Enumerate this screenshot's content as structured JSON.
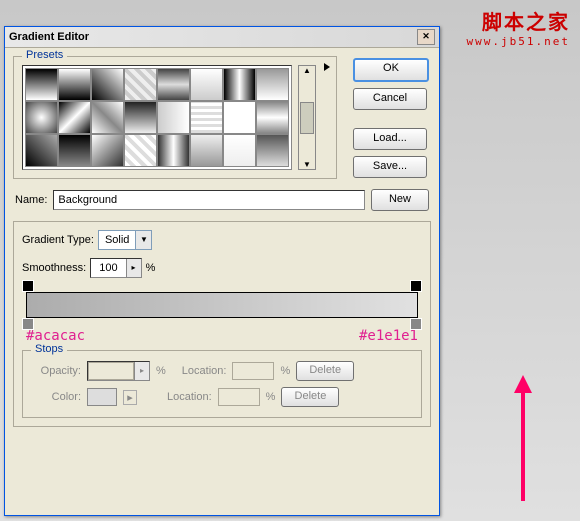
{
  "watermark": {
    "cn": "脚本之家",
    "en": "www.jb51.net"
  },
  "dialog": {
    "title": "Gradient Editor",
    "buttons": {
      "ok": "OK",
      "cancel": "Cancel",
      "load": "Load...",
      "save": "Save...",
      "new": "New"
    },
    "presets_label": "Presets",
    "name_label": "Name:",
    "name_value": "Background",
    "gradient_type_label": "Gradient Type:",
    "gradient_type_value": "Solid",
    "smoothness_label": "Smoothness:",
    "smoothness_value": "100",
    "percent": "%",
    "hex_left": "#acacac",
    "hex_right": "#e1e1e1",
    "stops": {
      "legend": "Stops",
      "opacity": "Opacity:",
      "color": "Color:",
      "location": "Location:",
      "delete": "Delete"
    },
    "presets": [
      "linear-gradient(#000,#fff)",
      "linear-gradient(#fff,#000)",
      "linear-gradient(45deg,#000,#fff)",
      "repeating-linear-gradient(45deg,#eee 0 4px,#ccc 4px 8px)",
      "linear-gradient(#444,#ddd,#444)",
      "linear-gradient(#fff,#ccc)",
      "linear-gradient(90deg,#000,#fff,#000)",
      "linear-gradient(#999,#fff)",
      "radial-gradient(#fff,#444)",
      "linear-gradient(135deg,#000,#fff,#000)",
      "linear-gradient(45deg,#fff,#888,#fff)",
      "linear-gradient(#222,#eee)",
      "linear-gradient(90deg,#ccc,#fff)",
      "repeating-linear-gradient(0deg,#ddd 0 3px,#fff 3px 6px)",
      "linear-gradient(#fff,#fff)",
      "linear-gradient(#888,#fff,#888)",
      "linear-gradient(45deg,#000,#aaa)",
      "linear-gradient(#000,#888)",
      "linear-gradient(135deg,#fff,#333)",
      "repeating-linear-gradient(45deg,#fff 0 4px,#ddd 4px 8px)",
      "linear-gradient(90deg,#333,#fff,#333)",
      "linear-gradient(#eee,#999)",
      "linear-gradient(#fff,#eee)",
      "linear-gradient(#555,#ddd)"
    ]
  }
}
